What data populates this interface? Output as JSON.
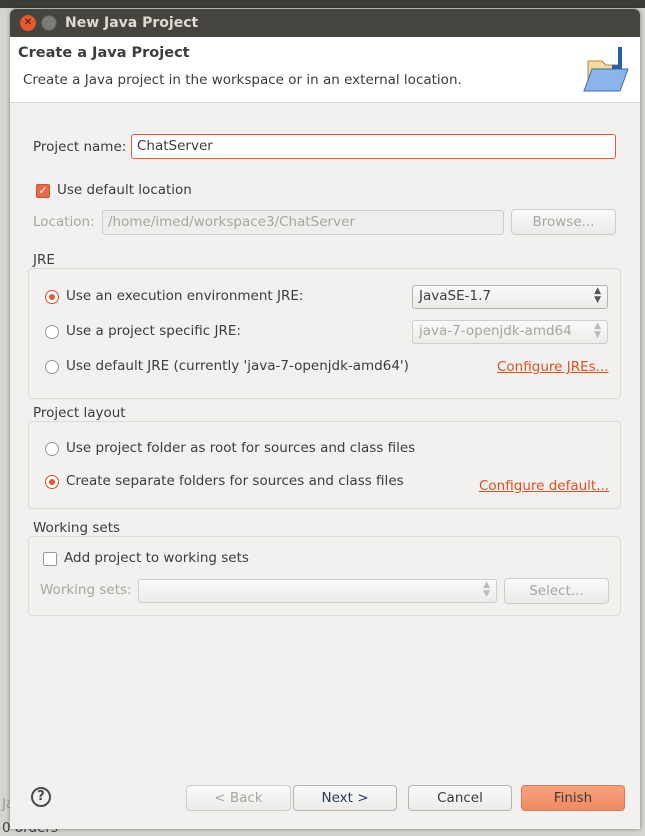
{
  "window": {
    "title": "New Java Project"
  },
  "header": {
    "title": "Create a Java Project",
    "description": "Create a Java project in the workspace or in an external location."
  },
  "project_name": {
    "label": "Project name:",
    "value": "ChatServer"
  },
  "default_location": {
    "label": "Use default location",
    "checked": true
  },
  "location": {
    "label": "Location:",
    "value": "/home/imed/workspace3/ChatServer",
    "browse": "Browse..."
  },
  "jre": {
    "label": "JRE",
    "options": [
      {
        "label": "Use an execution environment JRE:",
        "selected": true,
        "combo": "JavaSE-1.7"
      },
      {
        "label": "Use a project specific JRE:",
        "selected": false,
        "combo": "java-7-openjdk-amd64"
      },
      {
        "label": "Use default JRE (currently 'java-7-openjdk-amd64')",
        "selected": false,
        "link": "Configure JREs..."
      }
    ]
  },
  "layout": {
    "label": "Project layout",
    "options": [
      {
        "label": "Use project folder as root for sources and class files",
        "selected": false
      },
      {
        "label": "Create separate folders for sources and class files",
        "selected": true
      }
    ],
    "link": "Configure default..."
  },
  "working_sets": {
    "label": "Working sets",
    "add_label": "Add project to working sets",
    "checked": false,
    "field_label": "Working sets:",
    "value": "",
    "select": "Select..."
  },
  "buttons": {
    "back": "< Back",
    "next": "Next >",
    "cancel": "Cancel",
    "finish": "Finish"
  },
  "background": {
    "left_text": "Ja",
    "bottom_text": "0 orders"
  },
  "colors": {
    "accent": "#e8582e",
    "finish": "#f39670"
  }
}
